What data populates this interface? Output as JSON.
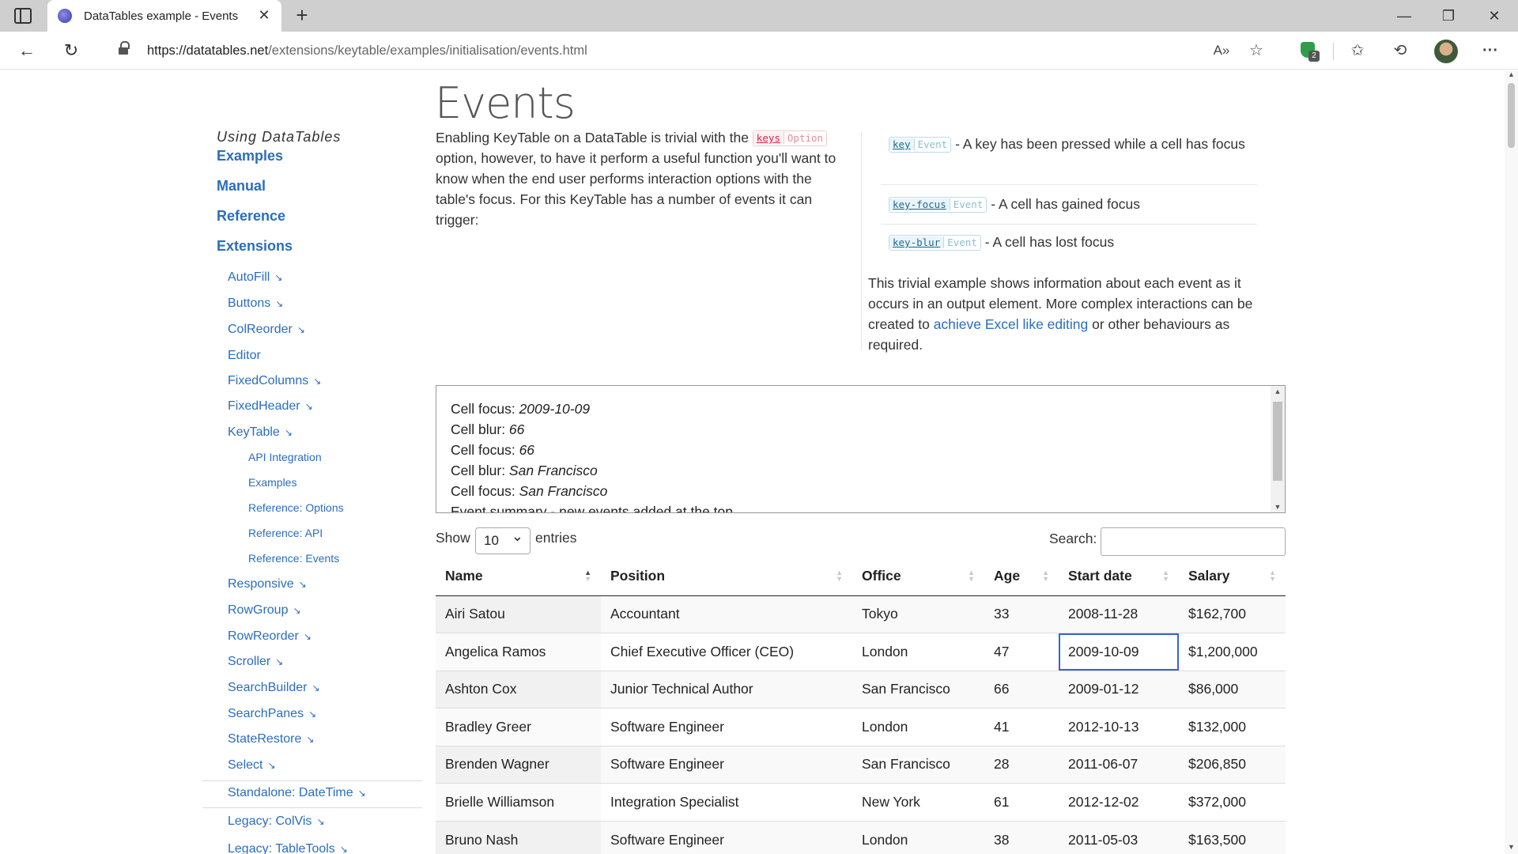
{
  "browser": {
    "tab_title": "DataTables example - Events",
    "url_host": "https://datatables.net",
    "url_path": "/extensions/keytable/examples/initialisation/events.html",
    "extension_badge": "2",
    "tab_close_glyph": "✕",
    "new_tab_glyph": "+",
    "min_glyph": "—",
    "max_glyph": "❐",
    "close_glyph": "✕",
    "back_glyph": "←",
    "reload_glyph": "↻",
    "read_aloud_glyph": "A»",
    "add_fav_glyph": "☆",
    "favorites_glyph": "✩",
    "history_glyph": "⟲",
    "more_glyph": "···"
  },
  "sidebar": {
    "heading": "Using DataTables",
    "top_links": [
      "Examples",
      "Manual",
      "Reference",
      "Extensions"
    ],
    "extensions": [
      "AutoFill",
      "Buttons",
      "ColReorder",
      "Editor",
      "FixedColumns",
      "FixedHeader",
      "KeyTable"
    ],
    "keytable_sub": [
      "API Integration",
      "Examples",
      "Reference: Options",
      "Reference: API",
      "Reference: Events"
    ],
    "extensions_more": [
      "Responsive",
      "RowGroup",
      "RowReorder",
      "Scroller",
      "SearchBuilder",
      "SearchPanes",
      "StateRestore",
      "Select"
    ],
    "standalone": "Standalone: DateTime",
    "legacy": [
      "Legacy: ColVis",
      "Legacy: TableTools"
    ],
    "arrow_glyph": "↘"
  },
  "page": {
    "title": "Events",
    "intro_before": "Enabling KeyTable on a DataTable is trivial with the ",
    "intro_option_kw": "keys",
    "intro_option_type": "Option",
    "intro_after": " option, however, to have it perform a useful function you'll want to know when the end user performs interaction options with the table's focus. For this KeyTable has a number of events it can trigger:",
    "events": [
      {
        "kw": "key",
        "type": "Event",
        "desc": " - A key has been pressed while a cell has focus"
      },
      {
        "kw": "key-focus",
        "type": "Event",
        "desc": " - A cell has gained focus"
      },
      {
        "kw": "key-blur",
        "type": "Event",
        "desc": " - A cell has lost focus"
      }
    ],
    "summary_before": "This trivial example shows information about each event as it occurs in an output element. More complex interactions can be created to ",
    "summary_link": "achieve Excel like editing",
    "summary_after": " or other behaviours as required."
  },
  "output": {
    "lines": [
      {
        "label": "Cell focus: ",
        "value": "2009-10-09"
      },
      {
        "label": "Cell blur: ",
        "value": "66"
      },
      {
        "label": "Cell focus: ",
        "value": "66"
      },
      {
        "label": "Cell blur: ",
        "value": "San Francisco"
      },
      {
        "label": "Cell focus: ",
        "value": "San Francisco"
      },
      {
        "label": "Event summary - new events added at the top",
        "value": ""
      }
    ]
  },
  "table_controls": {
    "show_label": "Show",
    "length_value": "10",
    "entries_label": "entries",
    "search_label": "Search:",
    "search_value": ""
  },
  "table": {
    "headers": [
      "Name",
      "Position",
      "Office",
      "Age",
      "Start date",
      "Salary"
    ],
    "rows": [
      [
        "Airi Satou",
        "Accountant",
        "Tokyo",
        "33",
        "2008-11-28",
        "$162,700"
      ],
      [
        "Angelica Ramos",
        "Chief Executive Officer (CEO)",
        "London",
        "47",
        "2009-10-09",
        "$1,200,000"
      ],
      [
        "Ashton Cox",
        "Junior Technical Author",
        "San Francisco",
        "66",
        "2009-01-12",
        "$86,000"
      ],
      [
        "Bradley Greer",
        "Software Engineer",
        "London",
        "41",
        "2012-10-13",
        "$132,000"
      ],
      [
        "Brenden Wagner",
        "Software Engineer",
        "San Francisco",
        "28",
        "2011-06-07",
        "$206,850"
      ],
      [
        "Brielle Williamson",
        "Integration Specialist",
        "New York",
        "61",
        "2012-12-02",
        "$372,000"
      ],
      [
        "Bruno Nash",
        "Software Engineer",
        "London",
        "38",
        "2011-05-03",
        "$163,500"
      ]
    ],
    "focused_cell": {
      "row": 1,
      "col": 4
    }
  },
  "colors": {
    "link": "#2a6ebb",
    "focus_outline": "#3366cc",
    "option_tag": "#d0254a",
    "event_tag": "#1f6b93"
  }
}
